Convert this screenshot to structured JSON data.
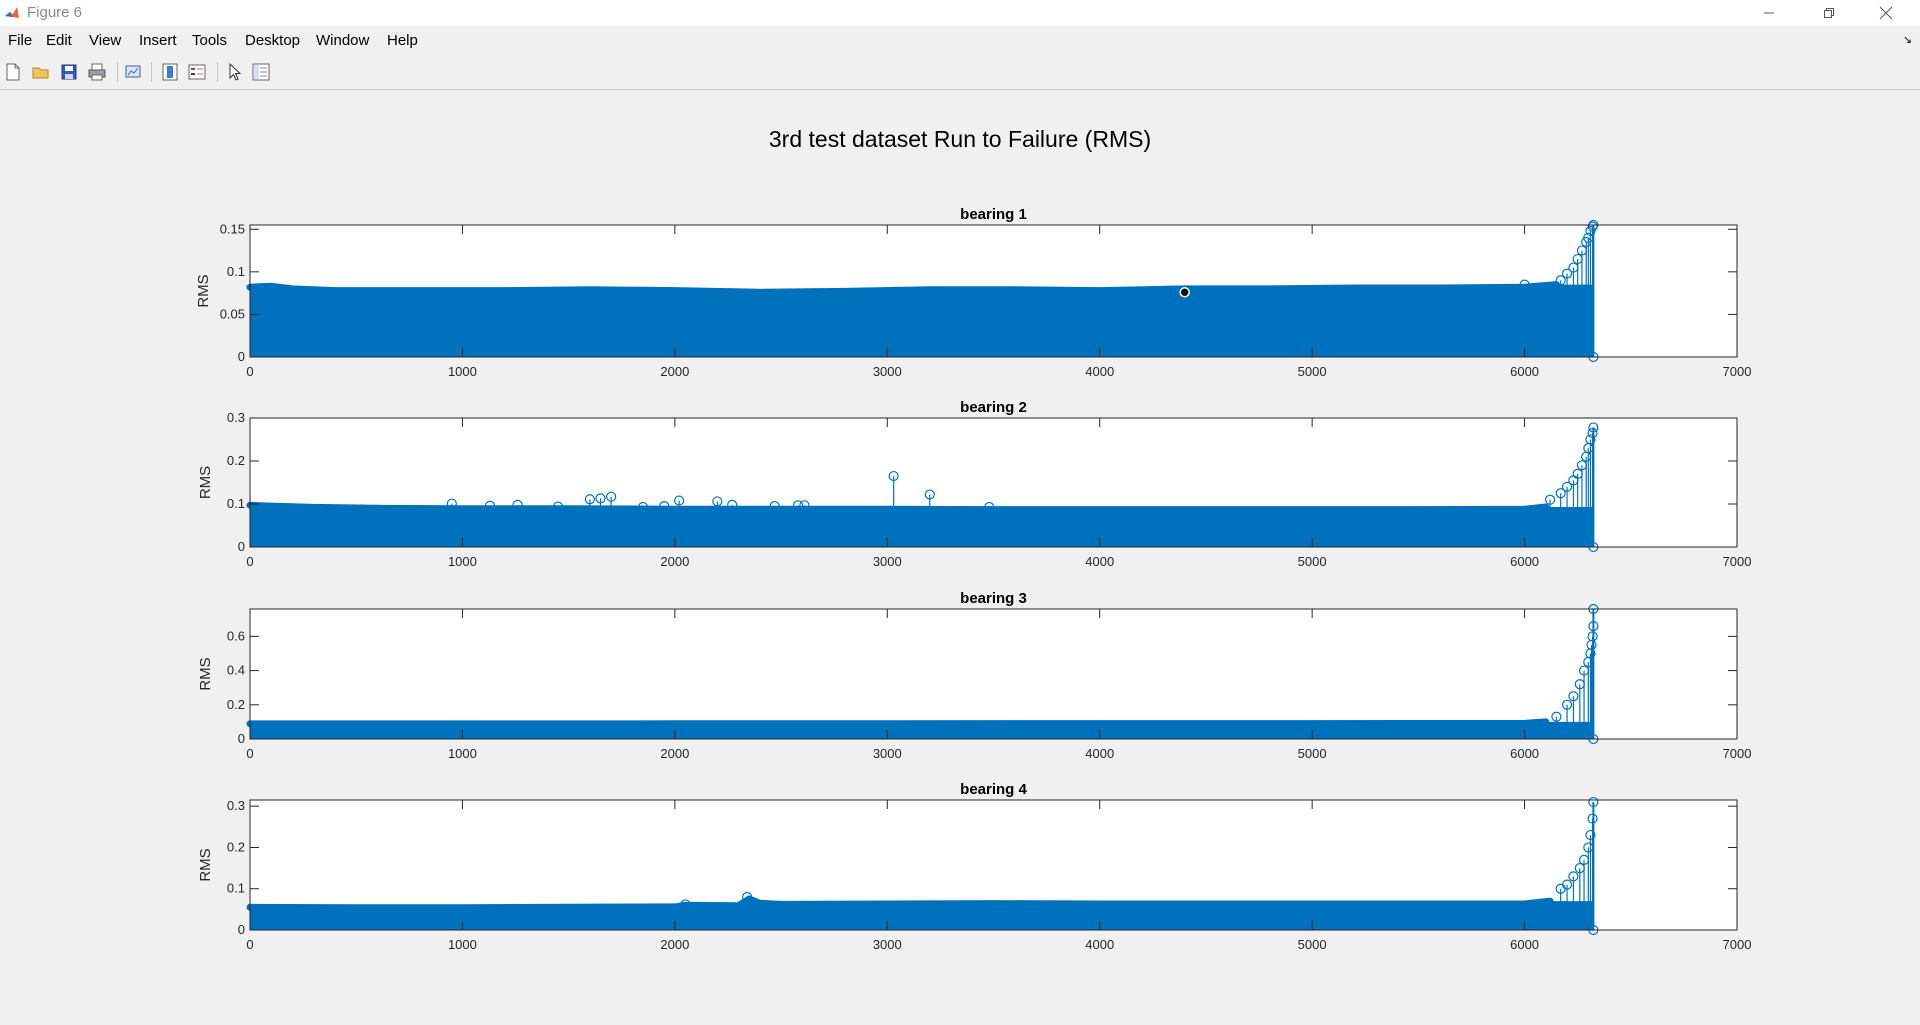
{
  "window": {
    "title": "Figure 6"
  },
  "menu": [
    "File",
    "Edit",
    "View",
    "Insert",
    "Tools",
    "Desktop",
    "Window",
    "Help"
  ],
  "toolbar": {
    "buttons": [
      "new-figure-icon",
      "open-file-icon",
      "save-icon",
      "print-icon",
      "link-plot-icon",
      "insert-colorbar-icon",
      "insert-legend-icon",
      "select-cursor-icon",
      "property-inspector-icon"
    ]
  },
  "figure": {
    "title": "3rd test dataset Run to Failure (RMS)"
  },
  "colors": {
    "series": "#0072bd",
    "axes_bg": "#ffffff",
    "figure_bg": "#f0f0f0"
  },
  "chart_data": [
    {
      "type": "stem",
      "title": "bearing 1",
      "xlabel": "",
      "ylabel": "RMS",
      "xlim": [
        0,
        7000
      ],
      "ylim": [
        0,
        0.155
      ],
      "xticks": [
        0,
        1000,
        2000,
        3000,
        4000,
        5000,
        6000,
        7000
      ],
      "yticks": [
        0,
        0.05,
        0.1,
        0.15
      ],
      "ytick_labels": [
        "0",
        "0.05",
        "0.1",
        "0.15"
      ],
      "baseline": {
        "x": [
          0,
          100,
          200,
          400,
          800,
          1200,
          1600,
          2000,
          2400,
          2800,
          3200,
          3600,
          4000,
          4400,
          4800,
          5200,
          5600,
          6000,
          6150
        ],
        "y": [
          0.082,
          0.083,
          0.08,
          0.078,
          0.078,
          0.078,
          0.079,
          0.078,
          0.076,
          0.077,
          0.079,
          0.079,
          0.078,
          0.08,
          0.08,
          0.081,
          0.081,
          0.082,
          0.085
        ]
      },
      "outliers": {
        "x": [
          6000,
          6170,
          6200,
          6230,
          6250,
          6270,
          6290,
          6300,
          6310,
          6320,
          6324,
          6324
        ],
        "y": [
          0.085,
          0.09,
          0.098,
          0.105,
          0.115,
          0.125,
          0.135,
          0.14,
          0.148,
          0.153,
          0.155,
          0.0
        ]
      },
      "end_x": 6324,
      "marker_point": {
        "x": 4400,
        "y": 0.076
      }
    },
    {
      "type": "stem",
      "title": "bearing 2",
      "xlabel": "",
      "ylabel": "RMS",
      "xlim": [
        0,
        7000
      ],
      "ylim": [
        0,
        0.3
      ],
      "xticks": [
        0,
        1000,
        2000,
        3000,
        4000,
        5000,
        6000,
        7000
      ],
      "yticks": [
        0,
        0.1,
        0.2,
        0.3
      ],
      "ytick_labels": [
        "0",
        "0.1",
        "0.2",
        "0.3"
      ],
      "baseline": {
        "x": [
          0,
          100,
          300,
          600,
          1000,
          1500,
          2000,
          2500,
          3000,
          3500,
          4000,
          4500,
          5000,
          5500,
          6000,
          6100
        ],
        "y": [
          0.097,
          0.095,
          0.092,
          0.09,
          0.089,
          0.089,
          0.088,
          0.088,
          0.088,
          0.087,
          0.087,
          0.087,
          0.087,
          0.087,
          0.088,
          0.093
        ]
      },
      "outliers": {
        "x": [
          950,
          1130,
          1260,
          1450,
          1600,
          1650,
          1700,
          1850,
          1950,
          2020,
          2200,
          2270,
          2470,
          2580,
          2610,
          3030,
          3200,
          3480,
          6120,
          6170,
          6200,
          6230,
          6250,
          6270,
          6290,
          6300,
          6310,
          6320,
          6324,
          6324
        ],
        "y": [
          0.101,
          0.096,
          0.098,
          0.094,
          0.111,
          0.113,
          0.117,
          0.093,
          0.095,
          0.108,
          0.106,
          0.098,
          0.095,
          0.097,
          0.097,
          0.165,
          0.122,
          0.093,
          0.11,
          0.125,
          0.14,
          0.155,
          0.17,
          0.19,
          0.21,
          0.23,
          0.25,
          0.265,
          0.278,
          0.0
        ]
      },
      "end_x": 6324
    },
    {
      "type": "stem",
      "title": "bearing 3",
      "xlabel": "",
      "ylabel": "RMS",
      "xlim": [
        0,
        7000
      ],
      "ylim": [
        0,
        0.76
      ],
      "xticks": [
        0,
        1000,
        2000,
        3000,
        4000,
        5000,
        6000,
        7000
      ],
      "yticks": [
        0,
        0.2,
        0.4,
        0.6
      ],
      "ytick_labels": [
        "0",
        "0.2",
        "0.4",
        "0.6"
      ],
      "baseline": {
        "x": [
          0,
          500,
          1000,
          2000,
          3000,
          4000,
          5000,
          6000,
          6100
        ],
        "y": [
          0.088,
          0.088,
          0.088,
          0.089,
          0.089,
          0.09,
          0.09,
          0.091,
          0.1
        ]
      },
      "outliers": {
        "x": [
          6150,
          6200,
          6230,
          6260,
          6280,
          6300,
          6310,
          6315,
          6320,
          6324,
          6324,
          6324
        ],
        "y": [
          0.13,
          0.2,
          0.25,
          0.32,
          0.4,
          0.45,
          0.5,
          0.55,
          0.6,
          0.66,
          0.76,
          0.0
        ]
      },
      "end_x": 6324
    },
    {
      "type": "stem",
      "title": "bearing 4",
      "xlabel": "",
      "ylabel": "RMS",
      "xlim": [
        0,
        7000
      ],
      "ylim": [
        0,
        0.315
      ],
      "xticks": [
        0,
        1000,
        2000,
        3000,
        4000,
        5000,
        6000,
        7000
      ],
      "yticks": [
        0,
        0.1,
        0.2,
        0.3
      ],
      "ytick_labels": [
        "0",
        "0.1",
        "0.2",
        "0.3"
      ],
      "baseline": {
        "x": [
          0,
          500,
          1000,
          1500,
          2000,
          2050,
          2300,
          2350,
          2400,
          2500,
          3000,
          3500,
          4000,
          4500,
          5000,
          5500,
          6000,
          6120
        ],
        "y": [
          0.055,
          0.054,
          0.054,
          0.055,
          0.056,
          0.06,
          0.059,
          0.075,
          0.065,
          0.062,
          0.063,
          0.064,
          0.063,
          0.063,
          0.063,
          0.063,
          0.063,
          0.07
        ]
      },
      "outliers": {
        "x": [
          2050,
          2340,
          6170,
          6200,
          6230,
          6260,
          6280,
          6300,
          6310,
          6320,
          6324,
          6324
        ],
        "y": [
          0.062,
          0.08,
          0.1,
          0.11,
          0.13,
          0.15,
          0.17,
          0.2,
          0.23,
          0.27,
          0.31,
          0.0
        ]
      },
      "end_x": 6324
    }
  ]
}
